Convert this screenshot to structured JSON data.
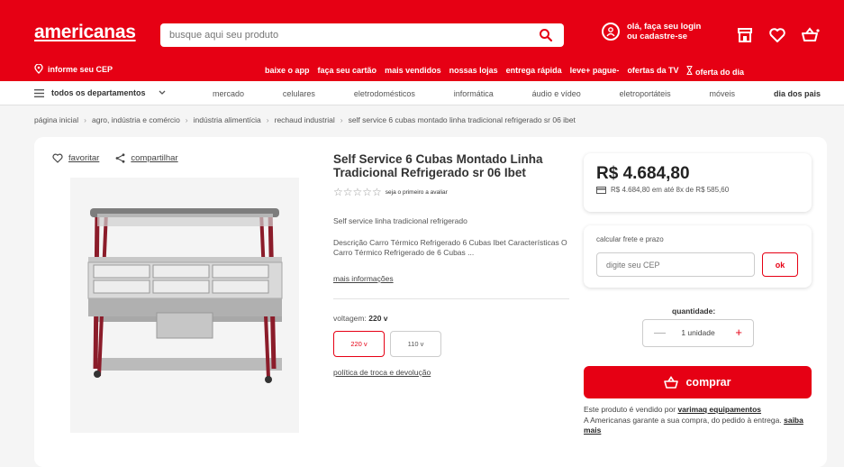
{
  "header": {
    "logo": "americanas",
    "search_placeholder": "busque aqui seu produto",
    "login_line1": "olá, faça seu login",
    "login_line2": "ou cadastre-se",
    "icons": [
      "store-icon",
      "heart-icon",
      "basket-icon"
    ]
  },
  "subbar": {
    "cep": "informe seu CEP",
    "links": [
      "baixe o app",
      "faça seu cartão",
      "mais vendidos",
      "nossas lojas",
      "entrega rápida",
      "leve+ pague-",
      "ofertas da TV",
      "oferta do dia"
    ]
  },
  "departments": {
    "all": "todos os departamentos",
    "links": [
      "mercado",
      "celulares",
      "eletrodomésticos",
      "informática",
      "áudio e vídeo",
      "eletroportáteis",
      "móveis",
      "dia dos pais"
    ]
  },
  "breadcrumb": [
    "página inicial",
    "agro, indústria e comércio",
    "indústria alimentícia",
    "rechaud industrial",
    "self service 6 cubas montado linha tradicional refrigerado sr 06 ibet"
  ],
  "product": {
    "favorite": "favoritar",
    "share": "compartilhar",
    "title": "Self Service 6 Cubas Montado Linha Tradicional Refrigerado sr 06 Ibet",
    "rating_text": "seja o primeiro a avaliar",
    "subtitle": "Self service linha tradicional refrigerado",
    "description": "Descrição Carro Térmico Refrigerado 6 Cubas Ibet Características O Carro Térmico Refrigerado de 6 Cubas ...",
    "more_info": "mais informações",
    "voltage_label": "voltagem:",
    "voltage_selected": "220 v",
    "voltage_options": [
      "220 v",
      "110 v"
    ],
    "policy": "política de troca e devolução"
  },
  "purchase": {
    "price": "R$ 4.684,80",
    "installments": "R$ 4.684,80 em até 8x de R$ 585,60",
    "freight_label": "calcular frete e prazo",
    "cep_placeholder": "digite seu CEP",
    "ok": "ok",
    "quantity_label": "quantidade:",
    "quantity_value": "1 unidade",
    "buy": "comprar",
    "seller_prefix": "Este produto é vendido por",
    "seller_name": "varimaq equipamentos",
    "guarantee": "A Americanas garante a sua compra, do pedido à entrega.",
    "learn_more": "saiba mais"
  },
  "colors": {
    "brand": "#e60014"
  }
}
